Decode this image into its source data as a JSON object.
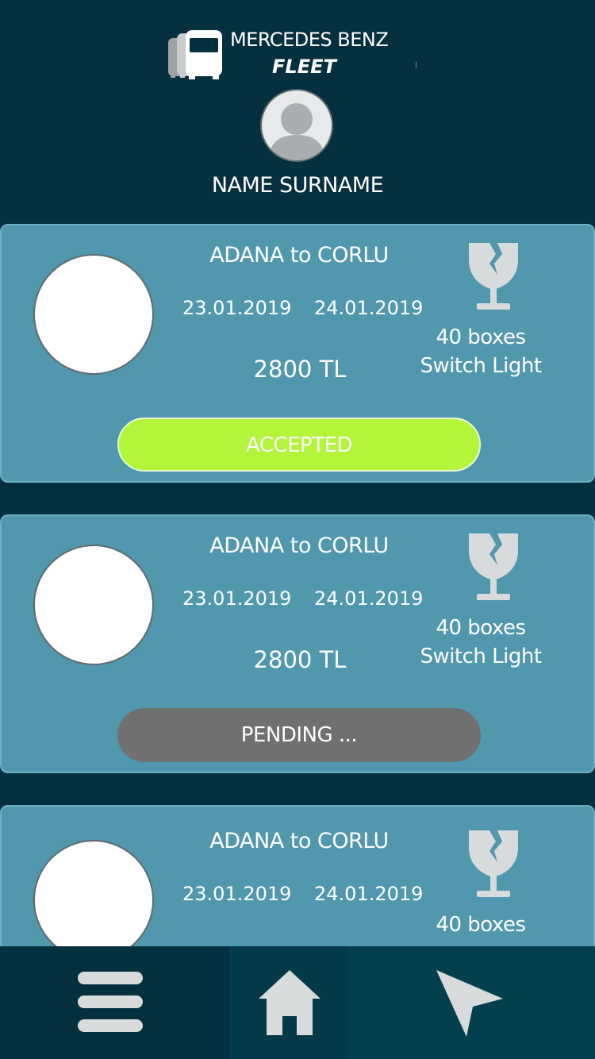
{
  "header": {
    "brand_line1": "MERCEDES BENZ",
    "brand_line2": "FLEET",
    "user_name": "NAME SURNAME"
  },
  "icons": {
    "logo": "trucks-logo-icon",
    "avatar": "user-avatar-icon",
    "fragile": "fragile-glass-icon",
    "menu": "hamburger-menu-icon",
    "home": "home-icon",
    "send": "navigation-arrow-icon"
  },
  "colors": {
    "background": "#05303f",
    "card": "#5197ae",
    "accepted": "#b3f53a",
    "pending": "#707070",
    "nav": "#043f4f"
  },
  "cards": [
    {
      "route": "ADANA to CORLU",
      "date_from": "23.01.2019",
      "date_to": "24.01.2019",
      "price": "2800 TL",
      "boxes": "40 boxes",
      "cargo": "Switch Light",
      "status": "ACCEPTED"
    },
    {
      "route": "ADANA to CORLU",
      "date_from": "23.01.2019",
      "date_to": "24.01.2019",
      "price": "2800 TL",
      "boxes": "40 boxes",
      "cargo": "Switch Light",
      "status": "PENDING ..."
    },
    {
      "route": "ADANA to CORLU",
      "date_from": "23.01.2019",
      "date_to": "24.01.2019",
      "boxes": "40 boxes"
    }
  ]
}
